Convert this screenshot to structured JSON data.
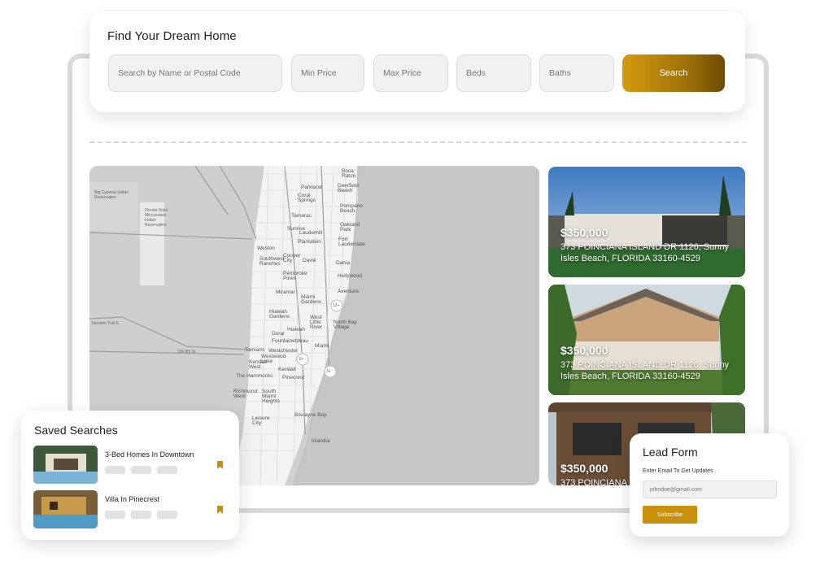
{
  "search": {
    "title": "Find Your Dream Home",
    "name_placeholder": "Search by Name or Postal Code",
    "min_price_placeholder": "Min Price",
    "max_price_placeholder": "Max Price",
    "beds_placeholder": "Beds",
    "baths_placeholder": "Baths",
    "button_label": "Search"
  },
  "map": {
    "labels": {
      "boca_raton": "Boca\nRaton",
      "deerfield_beach": "Deerfield\nBeach",
      "parkland": "Parkland",
      "coral_springs": "Coral\nSprings",
      "pompano_beach": "Pompano\nBeach",
      "tamarac": "Tamarac",
      "oakland_park": "Oakland\nPark",
      "sunrise": "Sunrise",
      "lauderhill": "Lauderhill",
      "plantation": "Plantation",
      "fort_lauderdale": "Fort\nLauderdale",
      "weston": "Weston",
      "southwest_ranches": "Southwest\nRanches",
      "cooper_city": "Cooper\nCity",
      "davie": "Davie",
      "dania": "Dania",
      "pembroke_pines": "Pembroke\nPines",
      "hollywood": "Hollywood",
      "miramar": "Miramar",
      "miami_gardens": "Miami\nGardens",
      "aventura": "Aventura",
      "hialeah_gardens": "Hialeah\nGardens",
      "west_little_river": "West\nLittle\nRiver",
      "north_bay_village": "North Bay\nVillage",
      "doral": "Doral",
      "hialeah": "Hialeah",
      "fontainebleau": "Fountainebleau",
      "tamiami": "Tamiami",
      "miami": "Miami",
      "westwood_lake": "Westwood\nLake",
      "westchester": "Westchester",
      "kendall_west": "Kendall\nWest",
      "kendall": "Kendall",
      "the_hammocks": "The Hammocks",
      "pinecrest": "Pinecrest",
      "richmond_west": "Richmond\nWest",
      "south_miami_heights": "South\nMiami\nHeights",
      "leisure_city": "Leisure\nCity",
      "biscayne_bay": "Biscayne Bay",
      "islandia": "Islandia",
      "big_cypress": "Big Cypress Indian\nReservation",
      "florida_state": "Florida State\nMiccosukee\nIndian\nReservation",
      "tamiami_trail": "Tamiami Trail E",
      "sw_8th_st": "SW 8th St",
      "cluster_a": "12+",
      "cluster_b": "8+",
      "cluster_c": "3+"
    }
  },
  "listings": [
    {
      "price": "$350,000",
      "address": "373 POINCIANA ISLAND DR 1126, Sunny Isles Beach, FLORIDA 33160-4529"
    },
    {
      "price": "$350,000",
      "address": "373 POINCIANA ISLAND DR 1126, Sunny Isles Beach, FLORIDA 33160-4529"
    },
    {
      "price": "$350,000",
      "address": "373 POINCIANA"
    }
  ],
  "saved_searches": {
    "title": "Saved Searches",
    "items": [
      {
        "label": "3-Bed Homes In Downtown"
      },
      {
        "label": "Villa In Pinecrest"
      }
    ]
  },
  "lead_form": {
    "title": "Lead Form",
    "subtitle": "Enter Email To Get Updates",
    "email_placeholder": "johndoe@gmail.com",
    "button_label": "Subscribe"
  },
  "colors": {
    "accent": "#c9900c",
    "map_land": "#cfcfcf",
    "map_urban": "#f4f4f4"
  }
}
